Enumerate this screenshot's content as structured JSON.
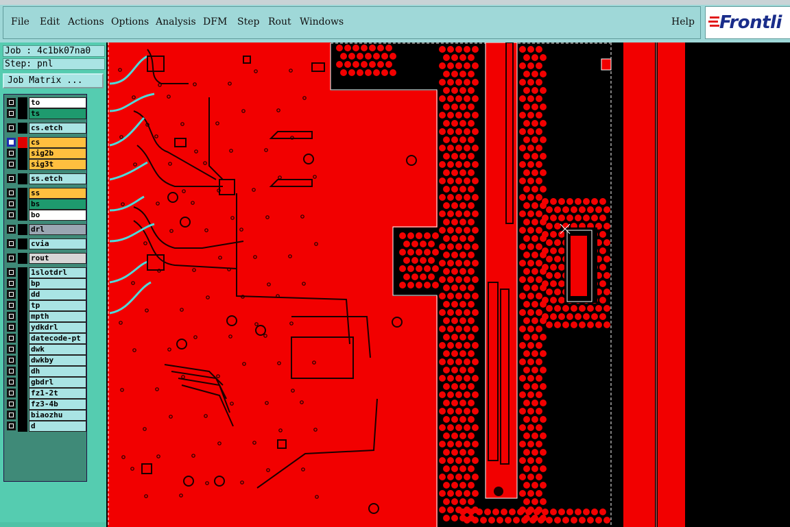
{
  "menu": {
    "items": [
      "File",
      "Edit",
      "Actions",
      "Options",
      "Analysis",
      "DFM",
      "Step",
      "Rout",
      "Windows"
    ],
    "help": "Help",
    "logo": "Frontli"
  },
  "job": {
    "job_label": "Job : 4c1bk07na0",
    "step_label": "Step: pnl",
    "job_matrix_button": "Job Matrix ..."
  },
  "layers": [
    {
      "name": "to",
      "color": "#ffffff",
      "swatch": "#000000",
      "selected": false
    },
    {
      "name": "ts",
      "color": "#1e9a6e",
      "swatch": "#000000",
      "selected": false
    },
    {
      "name": "cs.etch",
      "color": "#a9e4e4",
      "swatch": "#000000",
      "selected": false
    },
    {
      "name": "cs",
      "color": "#ffbf3f",
      "swatch": "#e00000",
      "selected": true
    },
    {
      "name": "sig2b",
      "color": "#ffbf3f",
      "swatch": "#000000",
      "selected": false
    },
    {
      "name": "sig3t",
      "color": "#ffbf3f",
      "swatch": "#000000",
      "selected": false
    },
    {
      "name": "ss.etch",
      "color": "#a9e4e4",
      "swatch": "#000000",
      "selected": false
    },
    {
      "name": "ss",
      "color": "#ffbf3f",
      "swatch": "#000000",
      "selected": false
    },
    {
      "name": "bs",
      "color": "#1e9a6e",
      "swatch": "#000000",
      "selected": false
    },
    {
      "name": "bo",
      "color": "#ffffff",
      "swatch": "#000000",
      "selected": false
    },
    {
      "name": "drl",
      "color": "#9aa6b2",
      "swatch": "#000000",
      "selected": false
    },
    {
      "name": "cvia",
      "color": "#a9e4e4",
      "swatch": "#000000",
      "selected": false
    },
    {
      "name": "rout",
      "color": "#d6d6d6",
      "swatch": "#000000",
      "selected": false
    },
    {
      "name": "1slotdrl",
      "color": "#a9e4e4",
      "swatch": "#000000",
      "selected": false
    },
    {
      "name": "bp",
      "color": "#a9e4e4",
      "swatch": "#000000",
      "selected": false
    },
    {
      "name": "dd",
      "color": "#a9e4e4",
      "swatch": "#000000",
      "selected": false
    },
    {
      "name": "tp",
      "color": "#a9e4e4",
      "swatch": "#000000",
      "selected": false
    },
    {
      "name": "mpth",
      "color": "#a9e4e4",
      "swatch": "#000000",
      "selected": false
    },
    {
      "name": "ydkdrl",
      "color": "#a9e4e4",
      "swatch": "#000000",
      "selected": false
    },
    {
      "name": "datecode-pt",
      "color": "#a9e4e4",
      "swatch": "#000000",
      "selected": false
    },
    {
      "name": "dwk",
      "color": "#a9e4e4",
      "swatch": "#000000",
      "selected": false
    },
    {
      "name": "dwkby",
      "color": "#a9e4e4",
      "swatch": "#000000",
      "selected": false
    },
    {
      "name": "dh",
      "color": "#a9e4e4",
      "swatch": "#000000",
      "selected": false
    },
    {
      "name": "gbdrl",
      "color": "#a9e4e4",
      "swatch": "#000000",
      "selected": false
    },
    {
      "name": "fz1-2t",
      "color": "#a9e4e4",
      "swatch": "#000000",
      "selected": false
    },
    {
      "name": "fz3-4b",
      "color": "#a9e4e4",
      "swatch": "#000000",
      "selected": false
    },
    {
      "name": "biaozhu",
      "color": "#a9e4e4",
      "swatch": "#000000",
      "selected": false
    },
    {
      "name": "d",
      "color": "#a9e4e4",
      "swatch": "#000000",
      "selected": false
    }
  ],
  "pcb": {
    "copper_color": "#f20000",
    "void_color": "#000000",
    "outline_color": "#ffffff",
    "trace_color": "#1a0000",
    "highlight_color": "#4fd8d8"
  }
}
